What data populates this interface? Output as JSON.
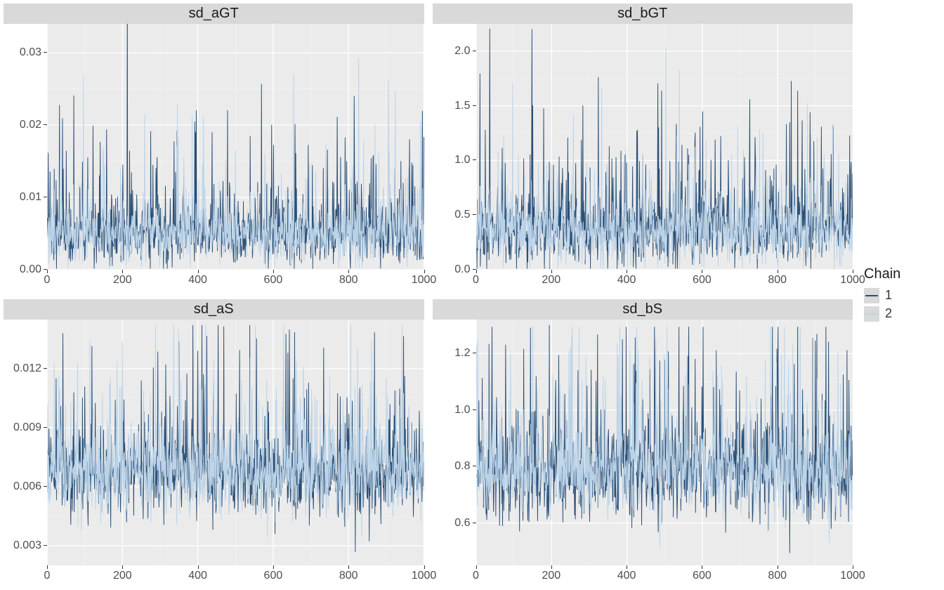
{
  "legend": {
    "title": "Chain",
    "items": [
      {
        "label": "1",
        "color": "#2b4f76"
      },
      {
        "label": "2",
        "color": "#bbd3e8"
      }
    ]
  },
  "x_ticks": [
    0,
    200,
    400,
    600,
    800,
    1000
  ],
  "panels": [
    {
      "key": "sd_aGT",
      "title": "sd_aGT",
      "y_ticks": [
        0.0,
        0.01,
        0.02,
        0.03
      ],
      "y_labels": [
        "0.00",
        "0.01",
        "0.02",
        "0.03"
      ],
      "ylim": [
        0,
        0.034
      ]
    },
    {
      "key": "sd_bGT",
      "title": "sd_bGT",
      "y_ticks": [
        0.0,
        0.5,
        1.0,
        1.5,
        2.0
      ],
      "y_labels": [
        "0.0",
        "0.5",
        "1.0",
        "1.5",
        "2.0"
      ],
      "ylim": [
        0,
        2.25
      ]
    },
    {
      "key": "sd_aS",
      "title": "sd_aS",
      "y_ticks": [
        0.003,
        0.006,
        0.009,
        0.012
      ],
      "y_labels": [
        "0.003",
        "0.006",
        "0.009",
        "0.012"
      ],
      "ylim": [
        0.002,
        0.0145
      ]
    },
    {
      "key": "sd_bS",
      "title": "sd_bS",
      "y_ticks": [
        0.6,
        0.8,
        1.0,
        1.2
      ],
      "y_labels": [
        "0.6",
        "0.8",
        "1.0",
        "1.2"
      ],
      "ylim": [
        0.45,
        1.32
      ]
    }
  ],
  "chart_data": [
    {
      "type": "line",
      "title": "sd_aGT",
      "xlabel": "",
      "ylabel": "",
      "xlim": [
        0,
        1000
      ],
      "ylim": [
        0,
        0.034
      ],
      "series": [
        {
          "name": "Chain 1",
          "mean": 0.0047,
          "sd": 0.0035,
          "n": 1000,
          "spikes": [
            0.038,
            0.022,
            0.02,
            0.024
          ]
        },
        {
          "name": "Chain 2",
          "mean": 0.0046,
          "sd": 0.003,
          "n": 1000,
          "spikes": [
            0.023,
            0.027
          ]
        }
      ],
      "note": "MCMC trace; values fluctuate ~0.002–0.012 with occasional spikes to ~0.02–0.038"
    },
    {
      "type": "line",
      "title": "sd_bGT",
      "xlabel": "",
      "ylabel": "",
      "xlim": [
        0,
        1000
      ],
      "ylim": [
        0,
        2.25
      ],
      "series": [
        {
          "name": "Chain 1",
          "mean": 0.35,
          "sd": 0.25,
          "n": 1000,
          "spikes": [
            2.2,
            1.76,
            1.3,
            1.22,
            1.33
          ]
        },
        {
          "name": "Chain 2",
          "mean": 0.33,
          "sd": 0.22,
          "n": 1000,
          "spikes": [
            1.66,
            1.05
          ]
        }
      ],
      "note": "MCMC trace; values fluctuate ~0.05–0.8 with spikes to ~1.0–2.2"
    },
    {
      "type": "line",
      "title": "sd_aS",
      "xlabel": "",
      "ylabel": "",
      "xlim": [
        0,
        1000
      ],
      "ylim": [
        0.002,
        0.0145
      ],
      "series": [
        {
          "name": "Chain 1",
          "mean": 0.0065,
          "sd": 0.0017,
          "n": 1000,
          "spikes": [
            0.0122,
            0.0115
          ]
        },
        {
          "name": "Chain 2",
          "mean": 0.0066,
          "sd": 0.0017,
          "n": 1000,
          "spikes": [
            0.014,
            0.0115
          ]
        }
      ],
      "note": "MCMC trace; dense band ~0.004–0.009, peaks to ~0.012–0.014"
    },
    {
      "type": "line",
      "title": "sd_bS",
      "xlabel": "",
      "ylabel": "",
      "xlim": [
        0,
        1000
      ],
      "ylim": [
        0.45,
        1.32
      ],
      "series": [
        {
          "name": "Chain 1",
          "mean": 0.77,
          "sd": 0.13,
          "n": 1000,
          "spikes": [
            1.3,
            1.25,
            1.18,
            1.15
          ]
        },
        {
          "name": "Chain 2",
          "mean": 0.77,
          "sd": 0.12,
          "n": 1000,
          "spikes": [
            1.12,
            1.1
          ]
        }
      ],
      "note": "MCMC trace; dense band ~0.6–0.95, peaks to ~1.1–1.3, dips to ~0.47"
    }
  ]
}
